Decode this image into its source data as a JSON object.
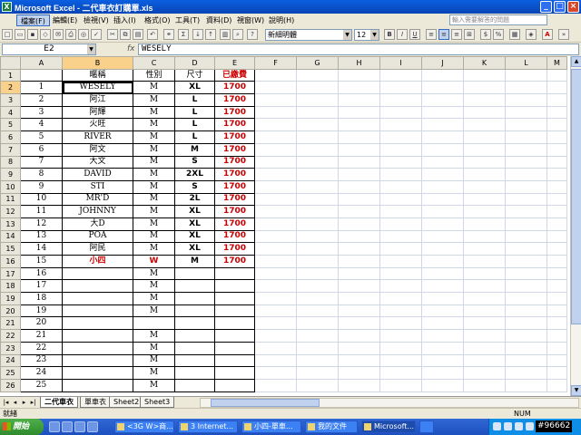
{
  "window": {
    "title": "Microsoft Excel - 二代車衣訂購單.xls",
    "controls": [
      "_",
      "□",
      "×"
    ]
  },
  "menu": {
    "items": [
      "檔案(F)",
      "編輯(E)",
      "檢視(V)",
      "插入(I)",
      "格式(O)",
      "工具(T)",
      "資料(D)",
      "視窗(W)",
      "說明(H)"
    ],
    "help_placeholder": "輸入需要解答的問題"
  },
  "toolbar": {
    "font_name": "新細明體",
    "font_size": "12"
  },
  "formula_bar": {
    "name_box": "E2",
    "fx": "fx",
    "value": "WESELY"
  },
  "sheet": {
    "columns": [
      "A",
      "B",
      "C",
      "D",
      "E",
      "F",
      "G",
      "H",
      "I",
      "J",
      "K",
      "L",
      "M"
    ],
    "header_row": [
      "",
      "暱稱",
      "性別",
      "尺寸",
      "已繳費"
    ],
    "rows": [
      [
        "1",
        "WESELY",
        "M",
        "XL",
        "1700"
      ],
      [
        "2",
        "阿江",
        "M",
        "L",
        "1700"
      ],
      [
        "3",
        "阿輝",
        "M",
        "L",
        "1700"
      ],
      [
        "4",
        "火旺",
        "M",
        "L",
        "1700"
      ],
      [
        "5",
        "RIVER",
        "M",
        "L",
        "1700"
      ],
      [
        "6",
        "阿文",
        "M",
        "M",
        "1700"
      ],
      [
        "7",
        "大文",
        "M",
        "S",
        "1700"
      ],
      [
        "8",
        "DAVID",
        "M",
        "2XL",
        "1700"
      ],
      [
        "9",
        "STI",
        "M",
        "S",
        "1700"
      ],
      [
        "10",
        "MR'D",
        "M",
        "2L",
        "1700"
      ],
      [
        "11",
        "JOHNNY",
        "M",
        "XL",
        "1700"
      ],
      [
        "12",
        "大D",
        "M",
        "XL",
        "1700"
      ],
      [
        "13",
        "POA",
        "M",
        "XL",
        "1700"
      ],
      [
        "14",
        "阿民",
        "M",
        "XL",
        "1700"
      ],
      [
        "15",
        "小四",
        "W",
        "M",
        "1700"
      ],
      [
        "16",
        "",
        "M",
        "",
        ""
      ],
      [
        "17",
        "",
        "M",
        "",
        ""
      ],
      [
        "18",
        "",
        "M",
        "",
        ""
      ],
      [
        "19",
        "",
        "M",
        "",
        ""
      ],
      [
        "20",
        "",
        "",
        "",
        ""
      ],
      [
        "21",
        "",
        "M",
        "",
        ""
      ],
      [
        "22",
        "",
        "M",
        "",
        ""
      ],
      [
        "23",
        "",
        "M",
        "",
        ""
      ],
      [
        "24",
        "",
        "M",
        "",
        ""
      ],
      [
        "25",
        "",
        "M",
        "",
        ""
      ]
    ]
  },
  "sheet_tabs": [
    "二代車衣",
    "單車衣",
    "Sheet2",
    "Sheet3"
  ],
  "status": {
    "ready": "就緒",
    "num": "NUM"
  },
  "taskbar": {
    "start": "開始",
    "items": [
      "<3G W>商...",
      "3 Internet...",
      "小四-單車...",
      "我的文件",
      "Microsoft..."
    ]
  },
  "watermark": "#96662",
  "colors": {
    "title_bar": "#0a5fe0",
    "highlight_red": "#cc0000",
    "selected_header": "#f9d18a",
    "taskbar": "#1d4fbf"
  }
}
